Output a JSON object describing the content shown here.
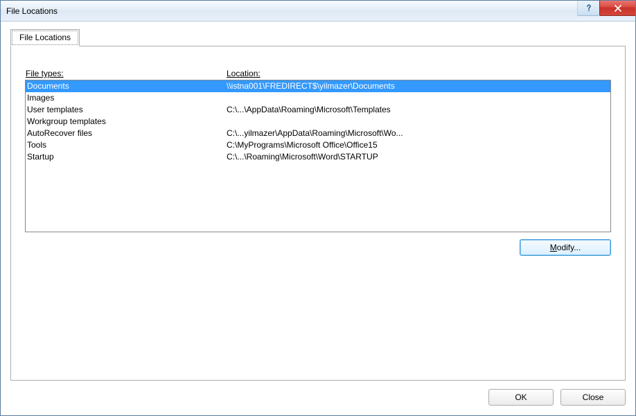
{
  "window": {
    "title": "File Locations"
  },
  "tab": {
    "label": "File Locations"
  },
  "columns": {
    "type_header": "File types:",
    "location_header": "Location:"
  },
  "rows": [
    {
      "type": "Documents",
      "location": "\\\\istna001\\FREDIRECT$\\yilmazer\\Documents",
      "selected": true
    },
    {
      "type": "Images",
      "location": "",
      "selected": false
    },
    {
      "type": "User templates",
      "location": "C:\\...\\AppData\\Roaming\\Microsoft\\Templates",
      "selected": false
    },
    {
      "type": "Workgroup templates",
      "location": "",
      "selected": false
    },
    {
      "type": "AutoRecover files",
      "location": "C:\\...yilmazer\\AppData\\Roaming\\Microsoft\\Wo...",
      "selected": false
    },
    {
      "type": "Tools",
      "location": "C:\\MyPrograms\\Microsoft Office\\Office15",
      "selected": false
    },
    {
      "type": "Startup",
      "location": "C:\\...\\Roaming\\Microsoft\\Word\\STARTUP",
      "selected": false
    }
  ],
  "buttons": {
    "modify": "Modify...",
    "ok": "OK",
    "close": "Close"
  }
}
